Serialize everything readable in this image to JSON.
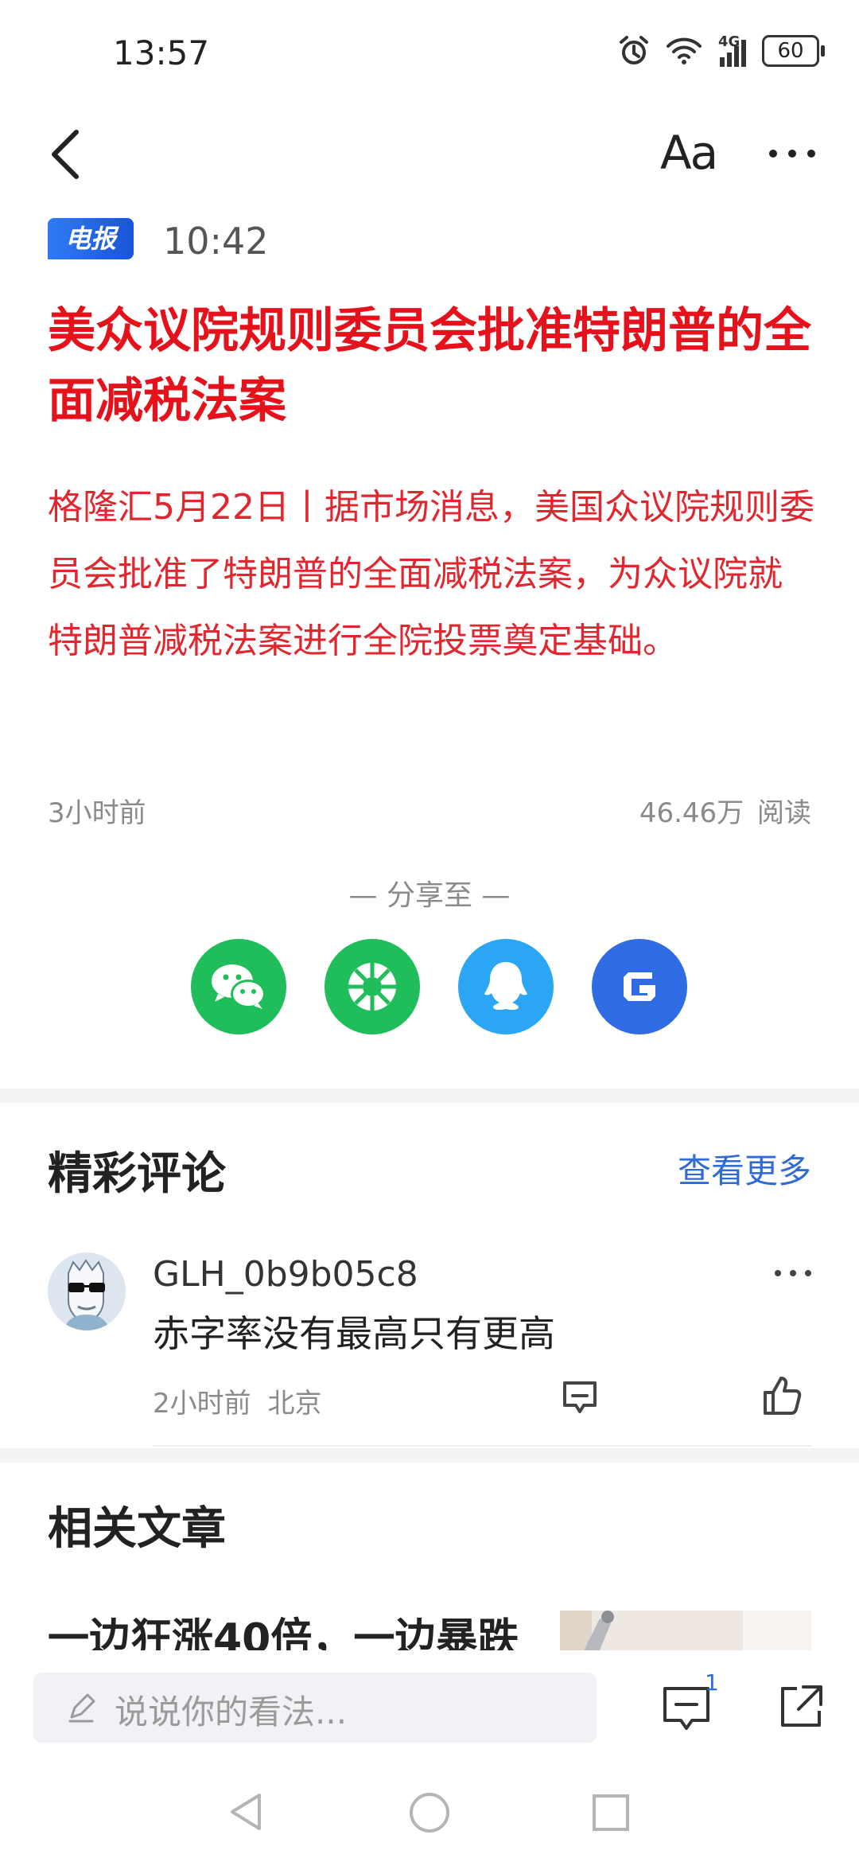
{
  "status_bar": {
    "time": "13:57",
    "network": "4G",
    "battery": "60",
    "icons": [
      "alarm-icon",
      "wifi-icon",
      "signal-icon",
      "battery-icon"
    ]
  },
  "header": {
    "font_size_label": "Aa",
    "icons": [
      "back-icon",
      "more-icon"
    ]
  },
  "article": {
    "tag": "电报",
    "time": "10:42",
    "title": "美众议院规则委员会批准特朗普的全面减税法案",
    "summary": "格隆汇5月22日丨据市场消息，美国众议院规则委员会批准了特朗普的全面减税法案，为众议院就特朗普减税法案进行全院投票奠定基础。",
    "posted_ago": "3小时前",
    "read_count": "46.46万 阅读",
    "title_color": "#e5121c"
  },
  "share": {
    "label": "— 分享至 —",
    "targets": [
      {
        "name": "wechat-icon",
        "color": "#1fbe5a"
      },
      {
        "name": "moments-icon",
        "color": "#1fbe5a"
      },
      {
        "name": "qq-icon",
        "color": "#2aa6f5"
      },
      {
        "name": "gelonghui-icon",
        "color": "#2f6be2"
      }
    ]
  },
  "comments": {
    "heading": "精彩评论",
    "see_more": "查看更多",
    "items": [
      {
        "username": "GLH_0b9b05c8",
        "text": "赤字率没有最高只有更高",
        "meta": "2小时前 北京"
      }
    ]
  },
  "related": {
    "heading": "相关文章",
    "articles": [
      {
        "title": "一边狂涨40倍，一边暴跌"
      }
    ]
  },
  "bottom_bar": {
    "placeholder": "说说你的看法...",
    "comment_count": "1",
    "icons": [
      "pen-icon",
      "comments-icon",
      "share-icon"
    ]
  },
  "accent_color": "#2f6bd6"
}
